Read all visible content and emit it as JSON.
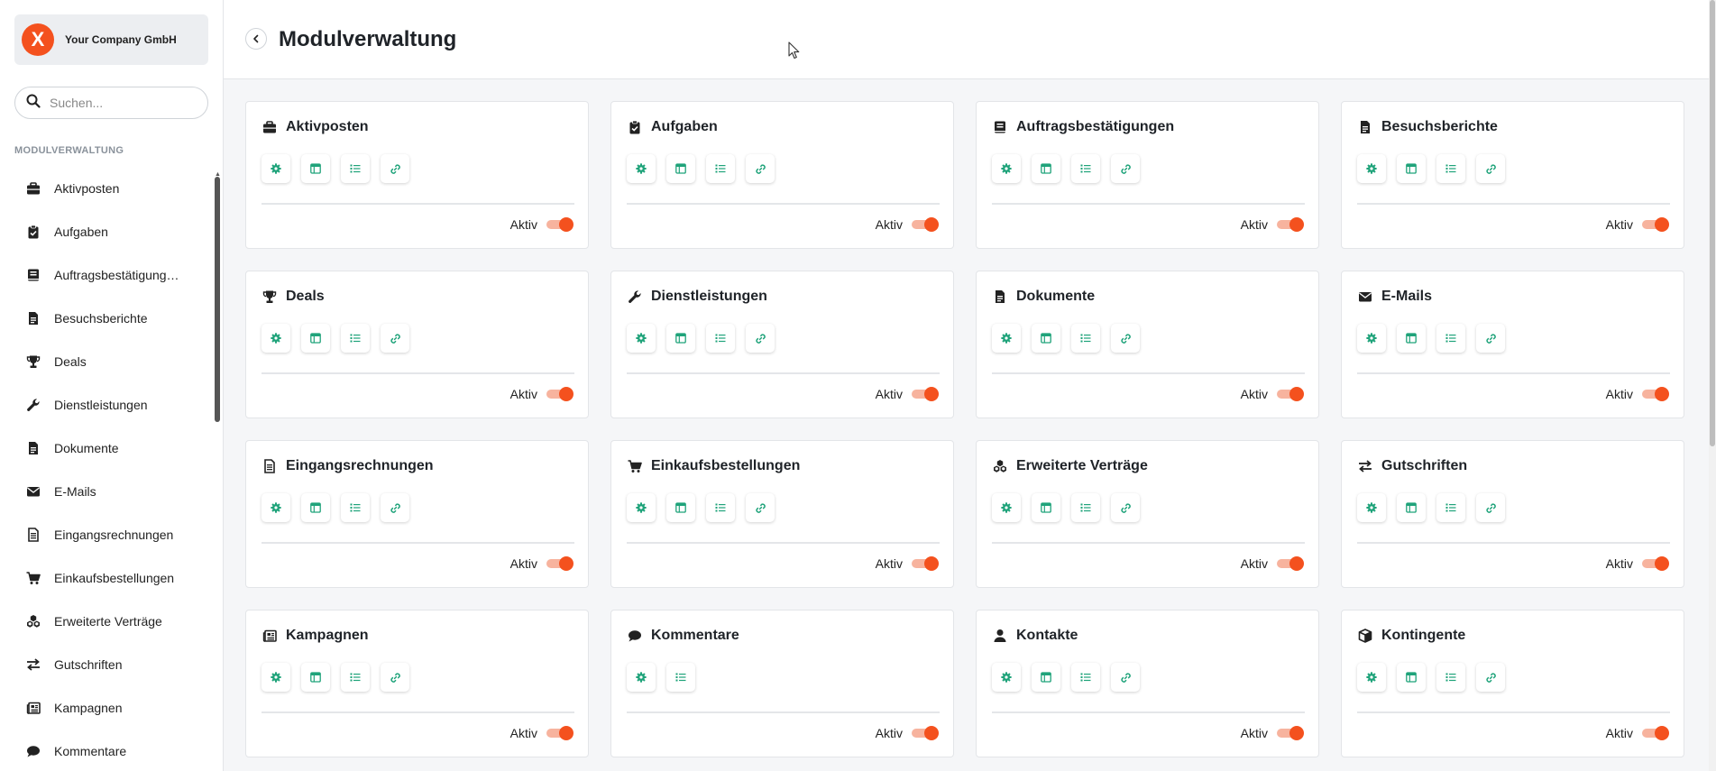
{
  "company": {
    "name": "Your Company GmbH",
    "logo_letter": "X"
  },
  "search": {
    "placeholder": "Suchen..."
  },
  "sidebar": {
    "section": "MODULVERWALTUNG",
    "items": [
      {
        "label": "Aktivposten",
        "icon": "briefcase-icon"
      },
      {
        "label": "Aufgaben",
        "icon": "clipboard-check-icon"
      },
      {
        "label": "Auftragsbestätigungen",
        "icon": "book-icon"
      },
      {
        "label": "Besuchsberichte",
        "icon": "document-icon"
      },
      {
        "label": "Deals",
        "icon": "trophy-icon"
      },
      {
        "label": "Dienstleistungen",
        "icon": "wrench-icon"
      },
      {
        "label": "Dokumente",
        "icon": "document-icon"
      },
      {
        "label": "E-Mails",
        "icon": "envelope-icon"
      },
      {
        "label": "Eingangsrechnungen",
        "icon": "invoice-icon"
      },
      {
        "label": "Einkaufsbestellungen",
        "icon": "cart-icon"
      },
      {
        "label": "Erweiterte Verträge",
        "icon": "cubes-icon"
      },
      {
        "label": "Gutschriften",
        "icon": "exchange-icon"
      },
      {
        "label": "Kampagnen",
        "icon": "newspaper-icon"
      },
      {
        "label": "Kommentare",
        "icon": "comment-icon"
      }
    ]
  },
  "header": {
    "title": "Modulverwaltung"
  },
  "modules": [
    {
      "name": "Aktivposten",
      "icon": "briefcase-icon",
      "actions": [
        "gear-icon",
        "layout-icon",
        "list-icon",
        "link-icon"
      ],
      "status": "Aktiv",
      "active": true
    },
    {
      "name": "Aufgaben",
      "icon": "clipboard-check-icon",
      "actions": [
        "gear-icon",
        "layout-icon",
        "list-icon",
        "link-icon"
      ],
      "status": "Aktiv",
      "active": true
    },
    {
      "name": "Auftragsbestätigungen",
      "icon": "book-icon",
      "actions": [
        "gear-icon",
        "layout-icon",
        "list-icon",
        "link-icon"
      ],
      "status": "Aktiv",
      "active": true
    },
    {
      "name": "Besuchsberichte",
      "icon": "document-icon",
      "actions": [
        "gear-icon",
        "layout-icon",
        "list-icon",
        "link-icon"
      ],
      "status": "Aktiv",
      "active": true
    },
    {
      "name": "Deals",
      "icon": "trophy-icon",
      "actions": [
        "gear-icon",
        "layout-icon",
        "list-icon",
        "link-icon"
      ],
      "status": "Aktiv",
      "active": true
    },
    {
      "name": "Dienstleistungen",
      "icon": "wrench-icon",
      "actions": [
        "gear-icon",
        "layout-icon",
        "list-icon",
        "link-icon"
      ],
      "status": "Aktiv",
      "active": true
    },
    {
      "name": "Dokumente",
      "icon": "document-icon",
      "actions": [
        "gear-icon",
        "layout-icon",
        "list-icon",
        "link-icon"
      ],
      "status": "Aktiv",
      "active": true
    },
    {
      "name": "E-Mails",
      "icon": "envelope-icon",
      "actions": [
        "gear-icon",
        "layout-icon",
        "list-icon",
        "link-icon"
      ],
      "status": "Aktiv",
      "active": true
    },
    {
      "name": "Eingangsrechnungen",
      "icon": "invoice-icon",
      "actions": [
        "gear-icon",
        "layout-icon",
        "list-icon",
        "link-icon"
      ],
      "status": "Aktiv",
      "active": true
    },
    {
      "name": "Einkaufsbestellungen",
      "icon": "cart-icon",
      "actions": [
        "gear-icon",
        "layout-icon",
        "list-icon",
        "link-icon"
      ],
      "status": "Aktiv",
      "active": true
    },
    {
      "name": "Erweiterte Verträge",
      "icon": "cubes-icon",
      "actions": [
        "gear-icon",
        "layout-icon",
        "list-icon",
        "link-icon"
      ],
      "status": "Aktiv",
      "active": true
    },
    {
      "name": "Gutschriften",
      "icon": "exchange-icon",
      "actions": [
        "gear-icon",
        "layout-icon",
        "list-icon",
        "link-icon"
      ],
      "status": "Aktiv",
      "active": true
    },
    {
      "name": "Kampagnen",
      "icon": "newspaper-icon",
      "actions": [
        "gear-icon",
        "layout-icon",
        "list-icon",
        "link-icon"
      ],
      "status": "Aktiv",
      "active": true
    },
    {
      "name": "Kommentare",
      "icon": "comment-icon",
      "actions": [
        "gear-icon",
        "list-icon"
      ],
      "status": "Aktiv",
      "active": true
    },
    {
      "name": "Kontakte",
      "icon": "user-icon",
      "actions": [
        "gear-icon",
        "layout-icon",
        "list-icon",
        "link-icon"
      ],
      "status": "Aktiv",
      "active": true
    },
    {
      "name": "Kontingente",
      "icon": "box-icon",
      "actions": [
        "gear-icon",
        "layout-icon",
        "list-icon",
        "link-icon"
      ],
      "status": "Aktiv",
      "active": true
    }
  ],
  "colors": {
    "accent": "#f4511e",
    "action_icon": "#1fa37a",
    "toggle_track": "#f7b39e"
  }
}
